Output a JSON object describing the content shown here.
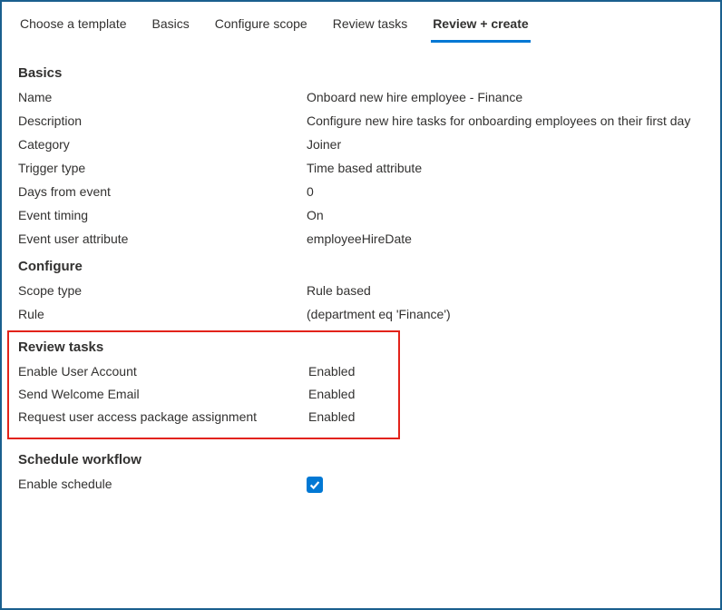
{
  "tabs": {
    "template": "Choose a template",
    "basics": "Basics",
    "scope": "Configure scope",
    "tasks": "Review tasks",
    "review": "Review + create"
  },
  "sections": {
    "basics": {
      "title": "Basics",
      "name_label": "Name",
      "name_value": "Onboard new hire employee - Finance",
      "description_label": "Description",
      "description_value": "Configure new hire tasks for onboarding employees on their first day",
      "category_label": "Category",
      "category_value": "Joiner",
      "trigger_type_label": "Trigger type",
      "trigger_type_value": "Time based attribute",
      "days_from_event_label": "Days from event",
      "days_from_event_value": "0",
      "event_timing_label": "Event timing",
      "event_timing_value": "On",
      "event_user_attribute_label": "Event user attribute",
      "event_user_attribute_value": "employeeHireDate"
    },
    "configure": {
      "title": "Configure",
      "scope_type_label": "Scope type",
      "scope_type_value": "Rule based",
      "rule_label": "Rule",
      "rule_value": " (department eq 'Finance')"
    },
    "review_tasks": {
      "title": "Review tasks",
      "task1_label": "Enable User Account",
      "task1_value": "Enabled",
      "task2_label": "Send Welcome Email",
      "task2_value": "Enabled",
      "task3_label": "Request user access package assignment",
      "task3_value": "Enabled"
    },
    "schedule": {
      "title": "Schedule workflow",
      "enable_label": "Enable schedule",
      "enable_checked": true
    }
  }
}
